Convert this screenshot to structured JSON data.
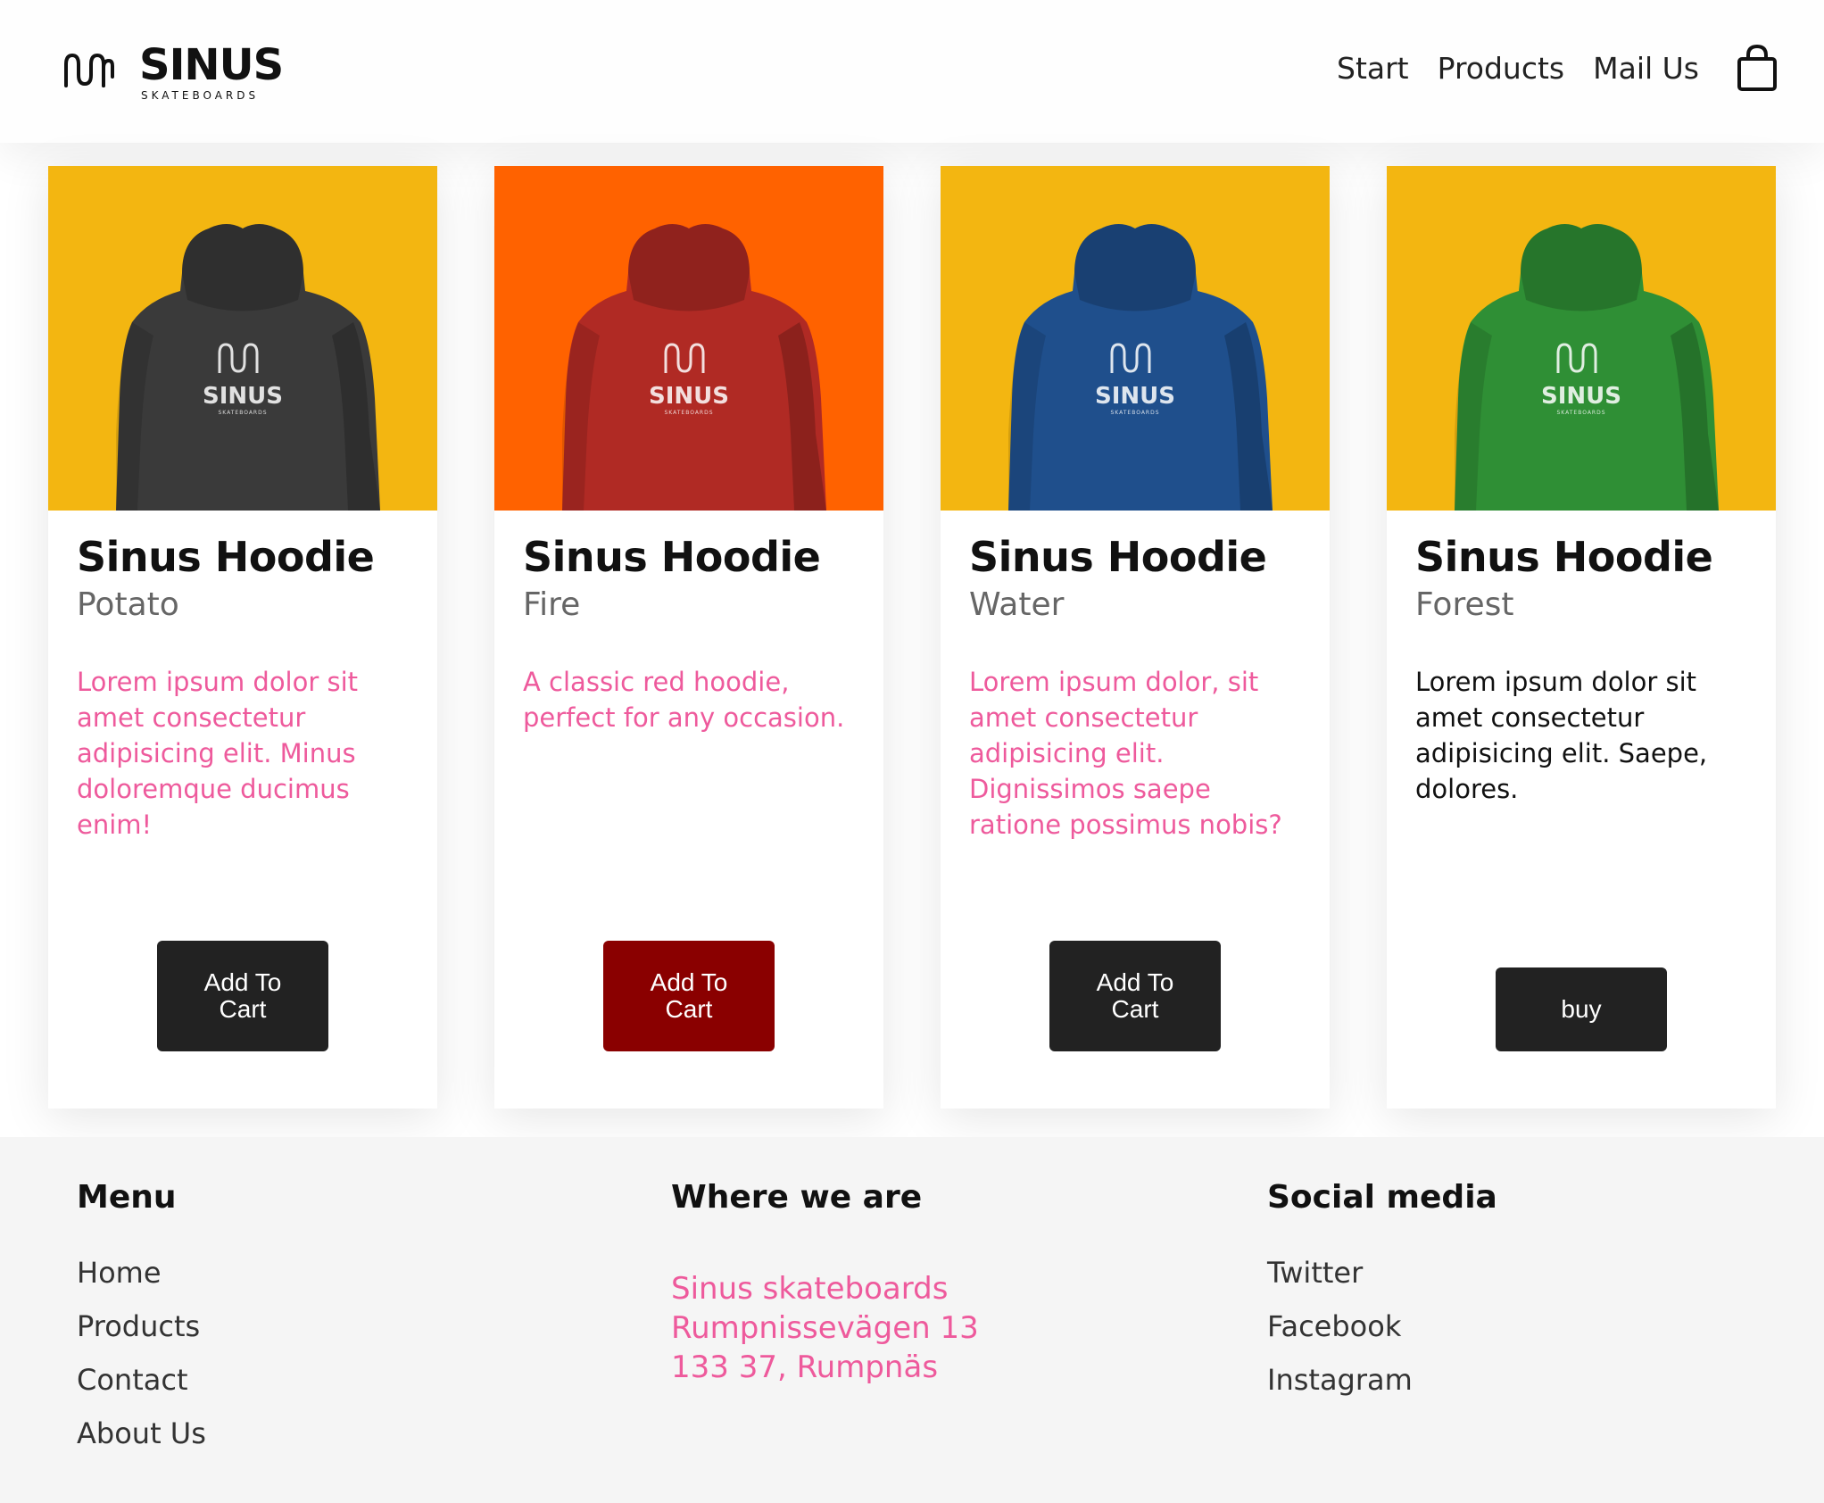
{
  "brand": {
    "name": "SINUS",
    "tagline": "SKATEBOARDS"
  },
  "nav": {
    "items": [
      "Start",
      "Products",
      "Mail Us"
    ]
  },
  "products": [
    {
      "title": "Sinus Hoodie",
      "variant": "Potato",
      "description": "Lorem ipsum dolor sit amet consectetur adipisicing elit. Minus doloremque ducimus enim!",
      "button": "Add To Cart",
      "bg_color": "#f3b611",
      "hoodie_color": "#3a3a3a",
      "desc_color": "#ee5a9c",
      "button_color": "#222222"
    },
    {
      "title": "Sinus Hoodie",
      "variant": "Fire",
      "description": "A classic red hoodie, perfect for any occasion.",
      "button": "Add To Cart",
      "bg_color": "#ff6200",
      "hoodie_color": "#b02a24",
      "desc_color": "#ee5a9c",
      "button_color": "#8a0000"
    },
    {
      "title": "Sinus Hoodie",
      "variant": "Water",
      "description": "Lorem ipsum dolor, sit amet consectetur adipisicing elit. Dignissimos saepe ratione possimus nobis?",
      "button": "Add To Cart",
      "bg_color": "#f3b611",
      "hoodie_color": "#1f4f8c",
      "desc_color": "#ee5a9c",
      "button_color": "#222222"
    },
    {
      "title": "Sinus Hoodie",
      "variant": "Forest",
      "description": "Lorem ipsum dolor sit amet consectetur adipisicing elit. Saepe, dolores.",
      "button": "buy",
      "bg_color": "#f3b611",
      "hoodie_color": "#2f8f35",
      "desc_color": "#111111",
      "button_color": "#222222"
    }
  ],
  "footer": {
    "menu": {
      "heading": "Menu",
      "items": [
        "Home",
        "Products",
        "Contact",
        "About Us"
      ]
    },
    "location": {
      "heading": "Where we are",
      "line1": "Sinus skateboards",
      "line2": "Rumpnissevägen 13",
      "line3": "133 37, Rumpnäs"
    },
    "social": {
      "heading": "Social media",
      "items": [
        "Twitter",
        "Facebook",
        "Instagram"
      ]
    }
  },
  "icons": {
    "logo": "sinus-wave-icon",
    "cart": "shopping-bag-icon"
  },
  "colors": {
    "accent_pink": "#ee5a9c",
    "footer_bg": "#f5f5f5"
  }
}
